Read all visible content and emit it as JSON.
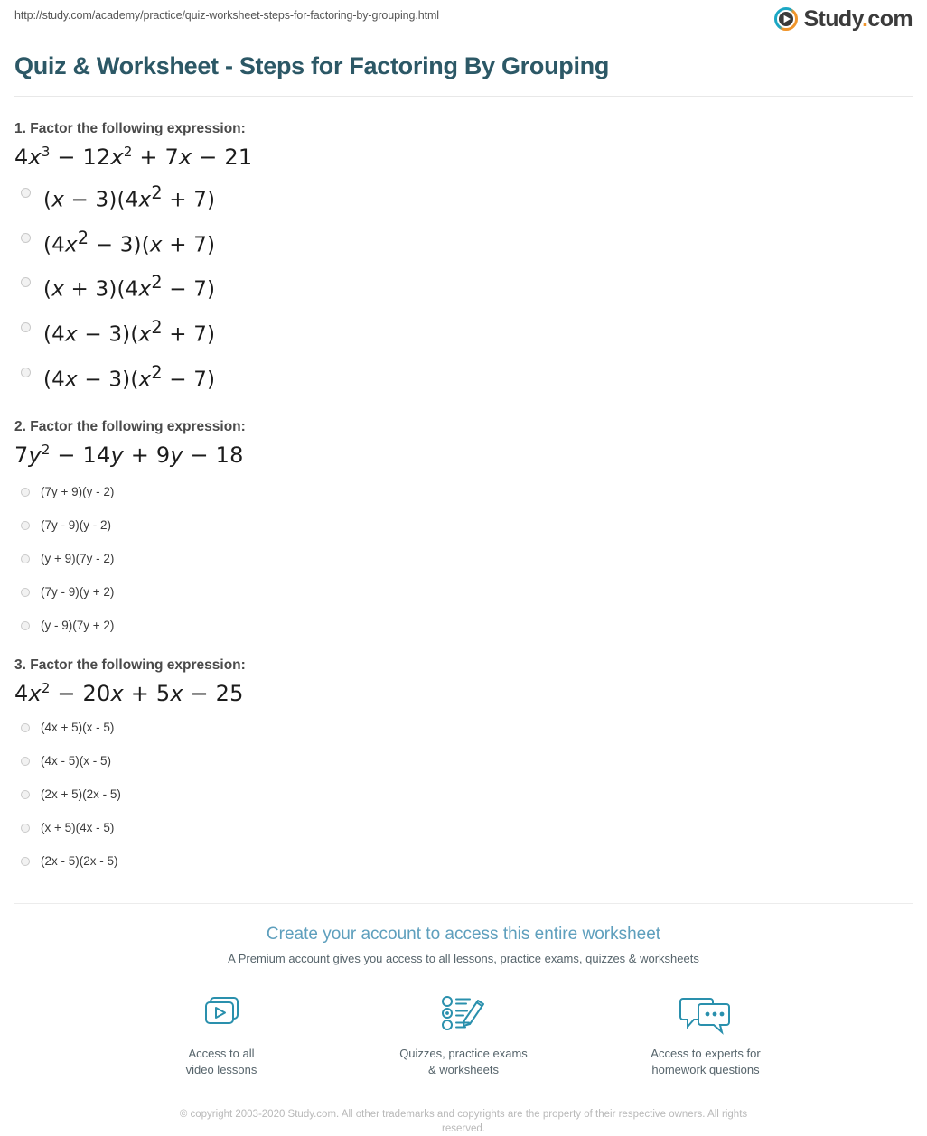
{
  "header": {
    "url": "http://study.com/academy/practice/quiz-worksheet-steps-for-factoring-by-grouping.html",
    "logo_text": "Study",
    "logo_dot": ".",
    "logo_suffix": "com",
    "logo_icon": "play-circle-icon",
    "brand_orange": "#f0952b",
    "brand_teal": "#1ba7c4"
  },
  "title": "Quiz & Worksheet - Steps for Factoring By Grouping",
  "title_color": "#2c5866",
  "questions": [
    {
      "number": "1.",
      "prompt": "1. Factor the following expression:",
      "expression_html": "4<span class=\"v\">x</span><sup>3</sup> &minus; 12<span class=\"v\">x</span><sup>2</sup> + 7<span class=\"v\">x</span> &minus; 21",
      "expression_text": "4x^3 - 12x^2 + 7x - 21",
      "style": "math",
      "options": [
        {
          "html": "(<span class=\"v\">x</span> &minus; 3)(4<span class=\"v\">x</span><sup>2</sup> + 7)",
          "text": "(x - 3)(4x^2 + 7)"
        },
        {
          "html": "(4<span class=\"v\">x</span><sup>2</sup> &minus; 3)(<span class=\"v\">x</span> + 7)",
          "text": "(4x^2 - 3)(x + 7)"
        },
        {
          "html": "(<span class=\"v\">x</span> + 3)(4<span class=\"v\">x</span><sup>2</sup> &minus; 7)",
          "text": "(x + 3)(4x^2 - 7)"
        },
        {
          "html": "(4<span class=\"v\">x</span> &minus; 3)(<span class=\"v\">x</span><sup>2</sup> + 7)",
          "text": "(4x - 3)(x^2 + 7)"
        },
        {
          "html": "(4<span class=\"v\">x</span> &minus; 3)(<span class=\"v\">x</span><sup>2</sup> &minus; 7)",
          "text": "(4x - 3)(x^2 - 7)"
        }
      ]
    },
    {
      "number": "2.",
      "prompt": "2. Factor the following expression:",
      "expression_html": "7<span class=\"v\">y</span><sup>2</sup> &minus; 14<span class=\"v\">y</span> + 9<span class=\"v\">y</span> &minus; 18",
      "expression_text": "7y^2 - 14y + 9y - 18",
      "style": "plain",
      "options": [
        {
          "html": "(7y + 9)(y - 2)",
          "text": "(7y + 9)(y - 2)"
        },
        {
          "html": "(7y - 9)(y - 2)",
          "text": "(7y - 9)(y - 2)"
        },
        {
          "html": "(y + 9)(7y - 2)",
          "text": "(y + 9)(7y - 2)"
        },
        {
          "html": "(7y - 9)(y + 2)",
          "text": "(7y - 9)(y + 2)"
        },
        {
          "html": "(y - 9)(7y + 2)",
          "text": "(y - 9)(7y + 2)"
        }
      ]
    },
    {
      "number": "3.",
      "prompt": "3. Factor the following expression:",
      "expression_html": "4<span class=\"v\">x</span><sup>2</sup> &minus; 20<span class=\"v\">x</span> + 5<span class=\"v\">x</span> &minus; 25",
      "expression_text": "4x^2 - 20x + 5x - 25",
      "style": "plain",
      "options": [
        {
          "html": "(4x + 5)(x - 5)",
          "text": "(4x + 5)(x - 5)"
        },
        {
          "html": "(4x - 5)(x - 5)",
          "text": "(4x - 5)(x - 5)"
        },
        {
          "html": "(2x + 5)(2x - 5)",
          "text": "(2x + 5)(2x - 5)"
        },
        {
          "html": "(x + 5)(4x - 5)",
          "text": "(x + 5)(4x - 5)"
        },
        {
          "html": "(2x - 5)(2x - 5)",
          "text": "(2x - 5)(2x - 5)"
        }
      ]
    }
  ],
  "footer": {
    "cta_title": "Create your account to access this entire worksheet",
    "cta_subtitle": "A Premium account gives you access to all lessons, practice exams, quizzes & worksheets",
    "cta_color": "#5e9fbd",
    "icon_color": "#2a90ad",
    "features": [
      {
        "icon": "video-lessons-icon",
        "line1": "Access to all",
        "line2": "video lessons"
      },
      {
        "icon": "quiz-pencil-icon",
        "line1": "Quizzes, practice exams",
        "line2": "& worksheets"
      },
      {
        "icon": "chat-bubbles-icon",
        "line1": "Access to experts for",
        "line2": "homework questions"
      }
    ],
    "copyright": "© copyright 2003-2020 Study.com. All other trademarks and copyrights are the property of their respective owners. All rights reserved."
  }
}
